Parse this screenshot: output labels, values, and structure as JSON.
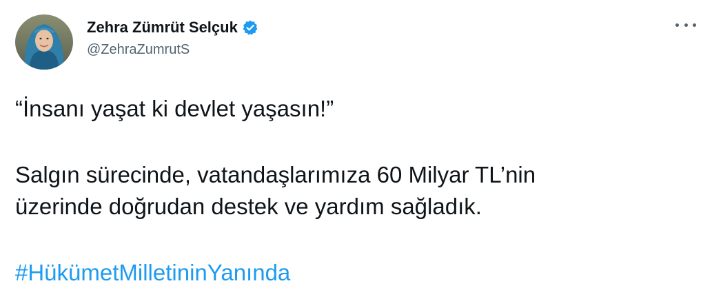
{
  "author": {
    "display_name": "Zehra Zümrüt Selçuk",
    "handle": "@ZehraZumrutS",
    "verified": true
  },
  "icons": {
    "avatar": "profile-photo",
    "verified": "verified-badge-icon",
    "more": "more-options-icon"
  },
  "tweet": {
    "line1": "“İnsanı yaşat ki devlet yaşasın!”",
    "line2": "Salgın sürecinde, vatandaşlarımıza 60 Milyar TL’nin",
    "line3": "üzerinde doğrudan destek ve yardım sağladık.",
    "hashtag": "#HükümetMilletininYanında"
  },
  "colors": {
    "text": "#0f1419",
    "secondary": "#536471",
    "link": "#1d9bf0",
    "verified": "#1d9bf0"
  }
}
